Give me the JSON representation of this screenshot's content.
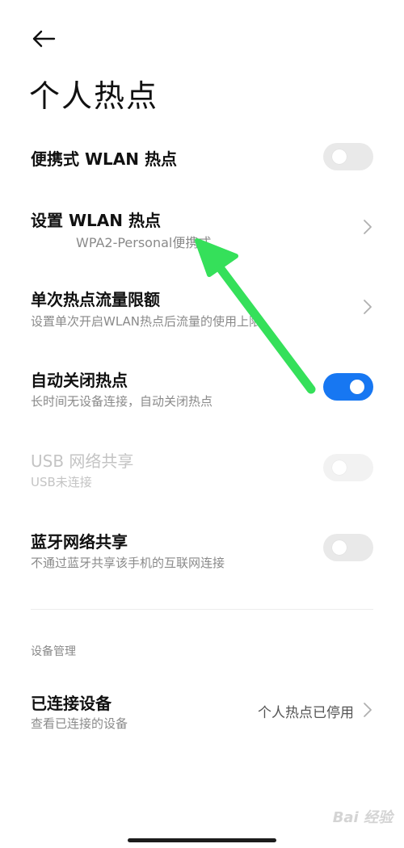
{
  "header": {
    "title": "个人热点"
  },
  "rows": {
    "portable": {
      "title": "便携式 WLAN 热点",
      "toggle": "off"
    },
    "setup": {
      "title": "设置 WLAN 热点",
      "subtitle": "WPA2-Personal便携式"
    },
    "limit": {
      "title": "单次热点流量限额",
      "subtitle": "设置单次开启WLAN热点后流量的使用上限"
    },
    "autoclose": {
      "title": "自动关闭热点",
      "subtitle": "长时间无设备连接，自动关闭热点",
      "toggle": "on"
    },
    "usb": {
      "title": "USB 网络共享",
      "subtitle": "USB未连接",
      "toggle": "disabled"
    },
    "bluetooth": {
      "title": "蓝牙网络共享",
      "subtitle": "不通过蓝牙共享该手机的互联网连接",
      "toggle": "off"
    }
  },
  "section": {
    "label": "设备管理"
  },
  "devices": {
    "title": "已连接设备",
    "subtitle": "查看已连接的设备",
    "value": "个人热点已停用"
  },
  "watermark": {
    "text": "Bai 经验"
  },
  "colors": {
    "accent": "#1777f2",
    "annotation_arrow": "#35e05a"
  }
}
